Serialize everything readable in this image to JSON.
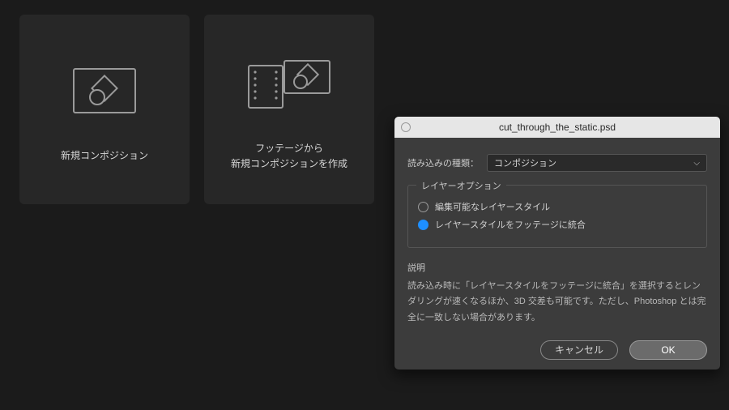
{
  "cards": {
    "new_composition": {
      "label": "新規コンポジション"
    },
    "from_footage": {
      "label_line1": "フッテージから",
      "label_line2": "新規コンポジションを作成"
    }
  },
  "dialog": {
    "title": "cut_through_the_static.psd",
    "import_kind_label": "読み込みの種類：",
    "import_kind_value": "コンポジション",
    "layer_options_legend": "レイヤーオプション",
    "radio_editable": "編集可能なレイヤースタイル",
    "radio_merge": "レイヤースタイルをフッテージに統合",
    "desc_title": "説明",
    "desc_text": "読み込み時に「レイヤースタイルをフッテージに統合」を選択するとレンダリングが速くなるほか、3D 交差も可能です。ただし、Photoshop とは完全に一致しない場合があります。",
    "cancel": "キャンセル",
    "ok": "OK"
  }
}
